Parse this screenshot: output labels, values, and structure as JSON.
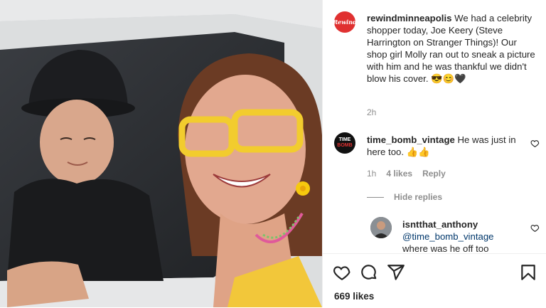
{
  "caption": {
    "avatar_text": "Rewind",
    "username": "rewindminneapolis",
    "text": "We had a celebrity shopper today, Joe Keery (Steve Harrington on Stranger Things)! Our shop girl Molly ran out to sneak a picture with him and he was thankful we didn't blow his cover. 😎😊🖤",
    "time": "2h"
  },
  "comments": [
    {
      "avatar_text": [
        "TIME",
        "BOMB"
      ],
      "username": "time_bomb_vintage",
      "text": "He was just in here too. 👍👍",
      "time": "1h",
      "likes": "4 likes",
      "reply": "Reply"
    }
  ],
  "hide_replies": "Hide replies",
  "reply": {
    "username": "isntthat_anthony",
    "mention": "@time_bomb_vintage",
    "text": "where was he off too"
  },
  "likes_count": "669 likes",
  "icons": [
    "heart-icon",
    "comment-icon",
    "share-icon",
    "bookmark-icon",
    "small-heart-icon"
  ],
  "colors": {
    "rewind_red": "#e03131",
    "link": "#00376b",
    "muted": "#8e8e8e"
  }
}
